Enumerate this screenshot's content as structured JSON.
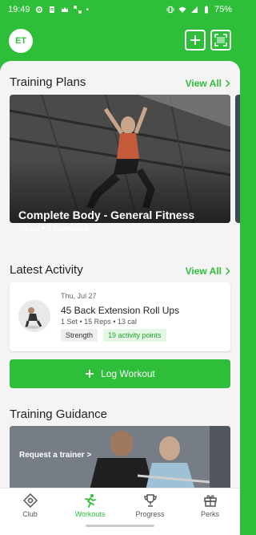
{
  "status_bar": {
    "time": "19:49",
    "dot": "•",
    "battery": "75%"
  },
  "header": {
    "avatar_initials": "ET"
  },
  "training_plans": {
    "title": "Training Plans",
    "view_all": "View All",
    "card": {
      "title": "Complete Body - General Fitness",
      "subtitle": "56 cal • 9 Exercises"
    }
  },
  "latest_activity": {
    "title": "Latest Activity",
    "view_all": "View All",
    "item": {
      "date": "Thu, Jul 27",
      "title": "45 Back Extension Roll Ups",
      "meta": "1 Set • 15 Reps • 13 cal",
      "tag_category": "Strength",
      "tag_points": "19 activity points"
    }
  },
  "log_button": {
    "label": "Log Workout"
  },
  "training_guidance": {
    "title": "Training Guidance",
    "card_text": "Request a trainer >"
  },
  "bottom_nav": {
    "items": [
      {
        "label": "Club",
        "icon": "club-icon"
      },
      {
        "label": "Workouts",
        "icon": "workouts-icon",
        "active": true
      },
      {
        "label": "Progress",
        "icon": "trophy-icon"
      },
      {
        "label": "Perks",
        "icon": "gift-icon"
      }
    ]
  },
  "colors": {
    "brand_green": "#2fbe3a",
    "background": "#f4f4f4"
  }
}
